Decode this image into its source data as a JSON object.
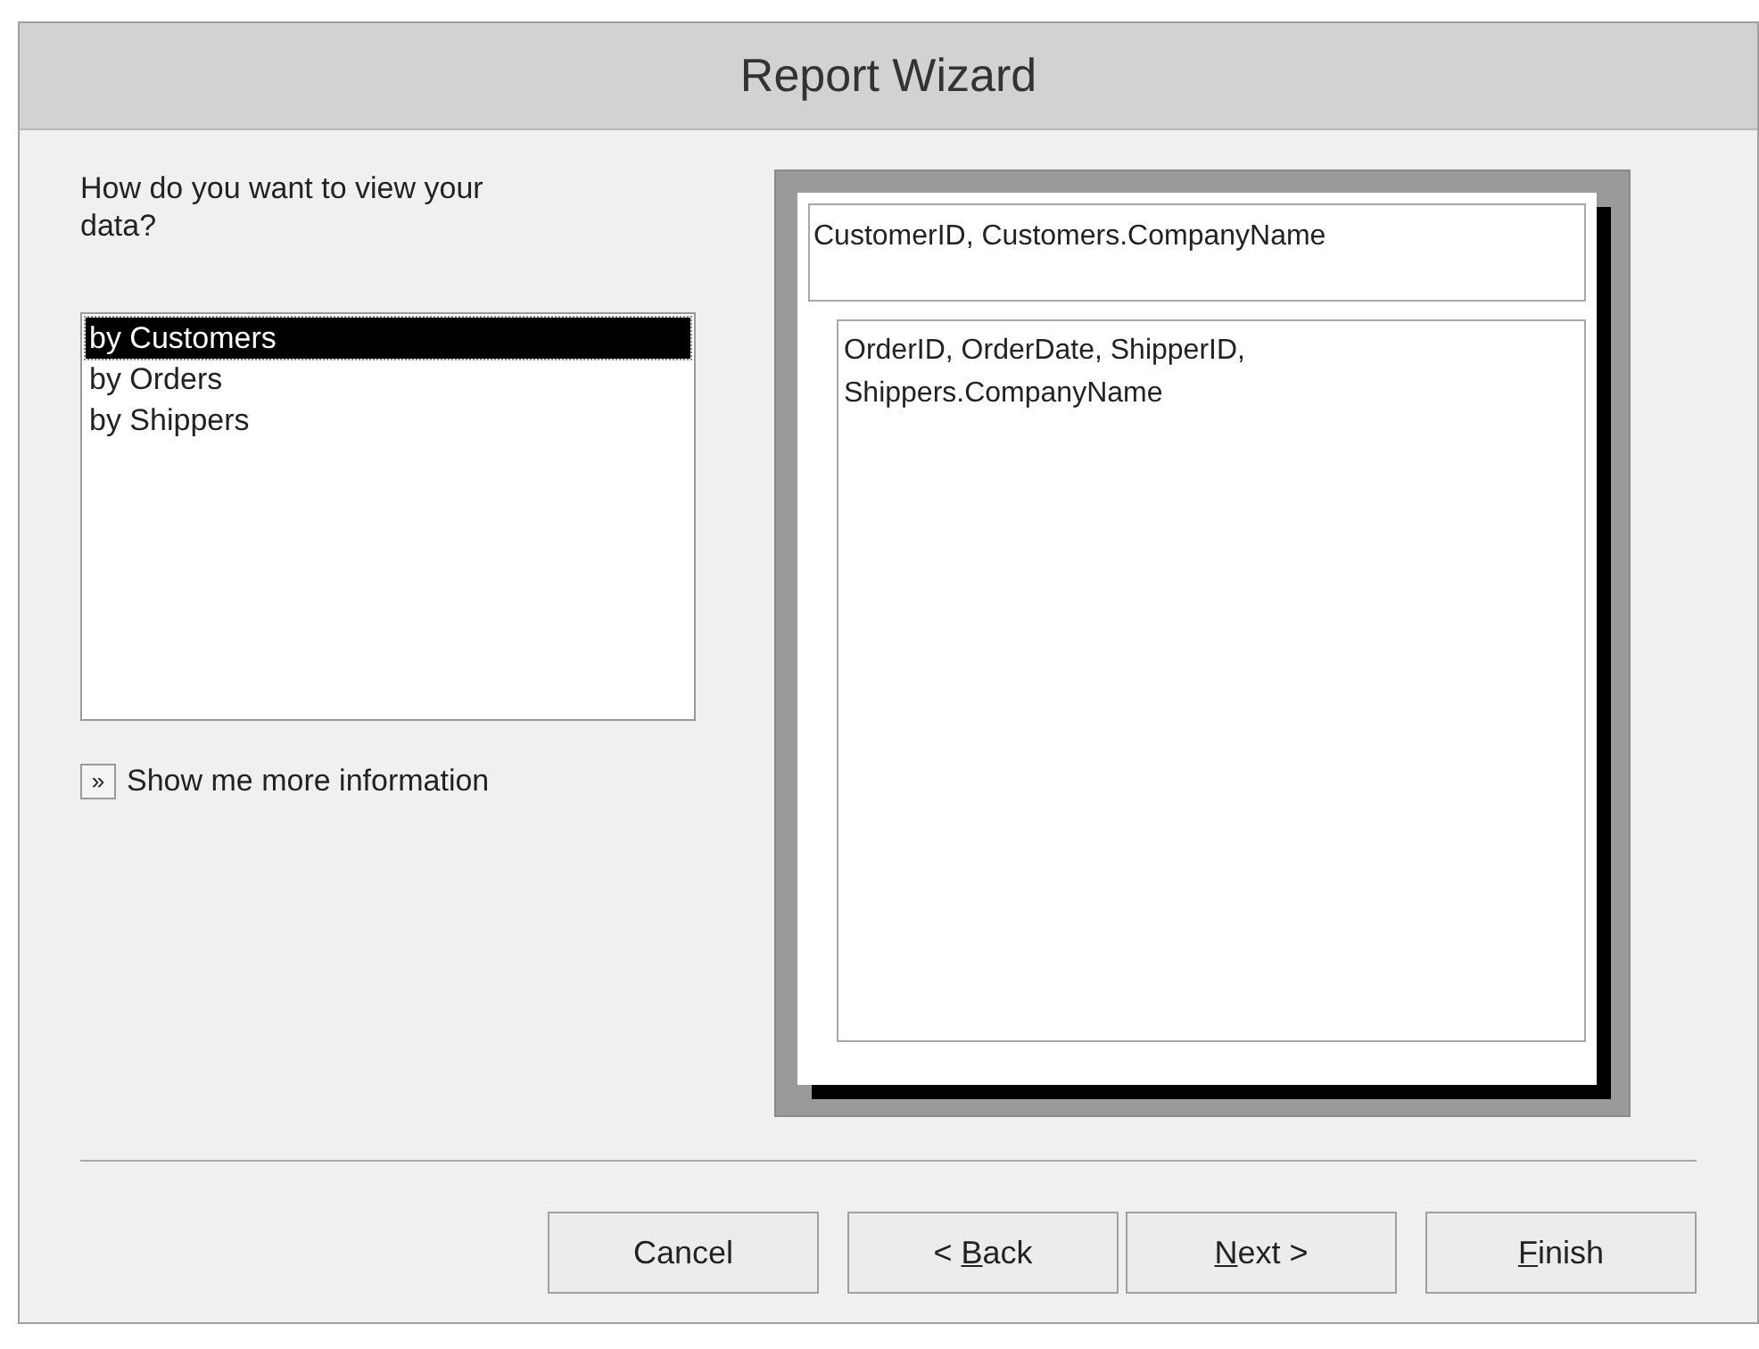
{
  "window": {
    "title": "Report Wizard"
  },
  "prompt": "How do you want to view your data?",
  "view_options": [
    {
      "label": "by Customers",
      "selected": true
    },
    {
      "label": "by Orders",
      "selected": false
    },
    {
      "label": "by Shippers",
      "selected": false
    }
  ],
  "more_info": {
    "icon_text": "»",
    "label": "Show me more information"
  },
  "preview": {
    "group_header": "CustomerID, Customers.CompanyName",
    "detail": "OrderID, OrderDate, ShipperID, Shippers.CompanyName"
  },
  "buttons": [
    {
      "label": "Cancel"
    },
    {
      "before": "< ",
      "access_key": "B",
      "after": "ack"
    },
    {
      "access_key": "N",
      "after": "ext >"
    },
    {
      "access_key": "F",
      "after": "inish"
    }
  ]
}
